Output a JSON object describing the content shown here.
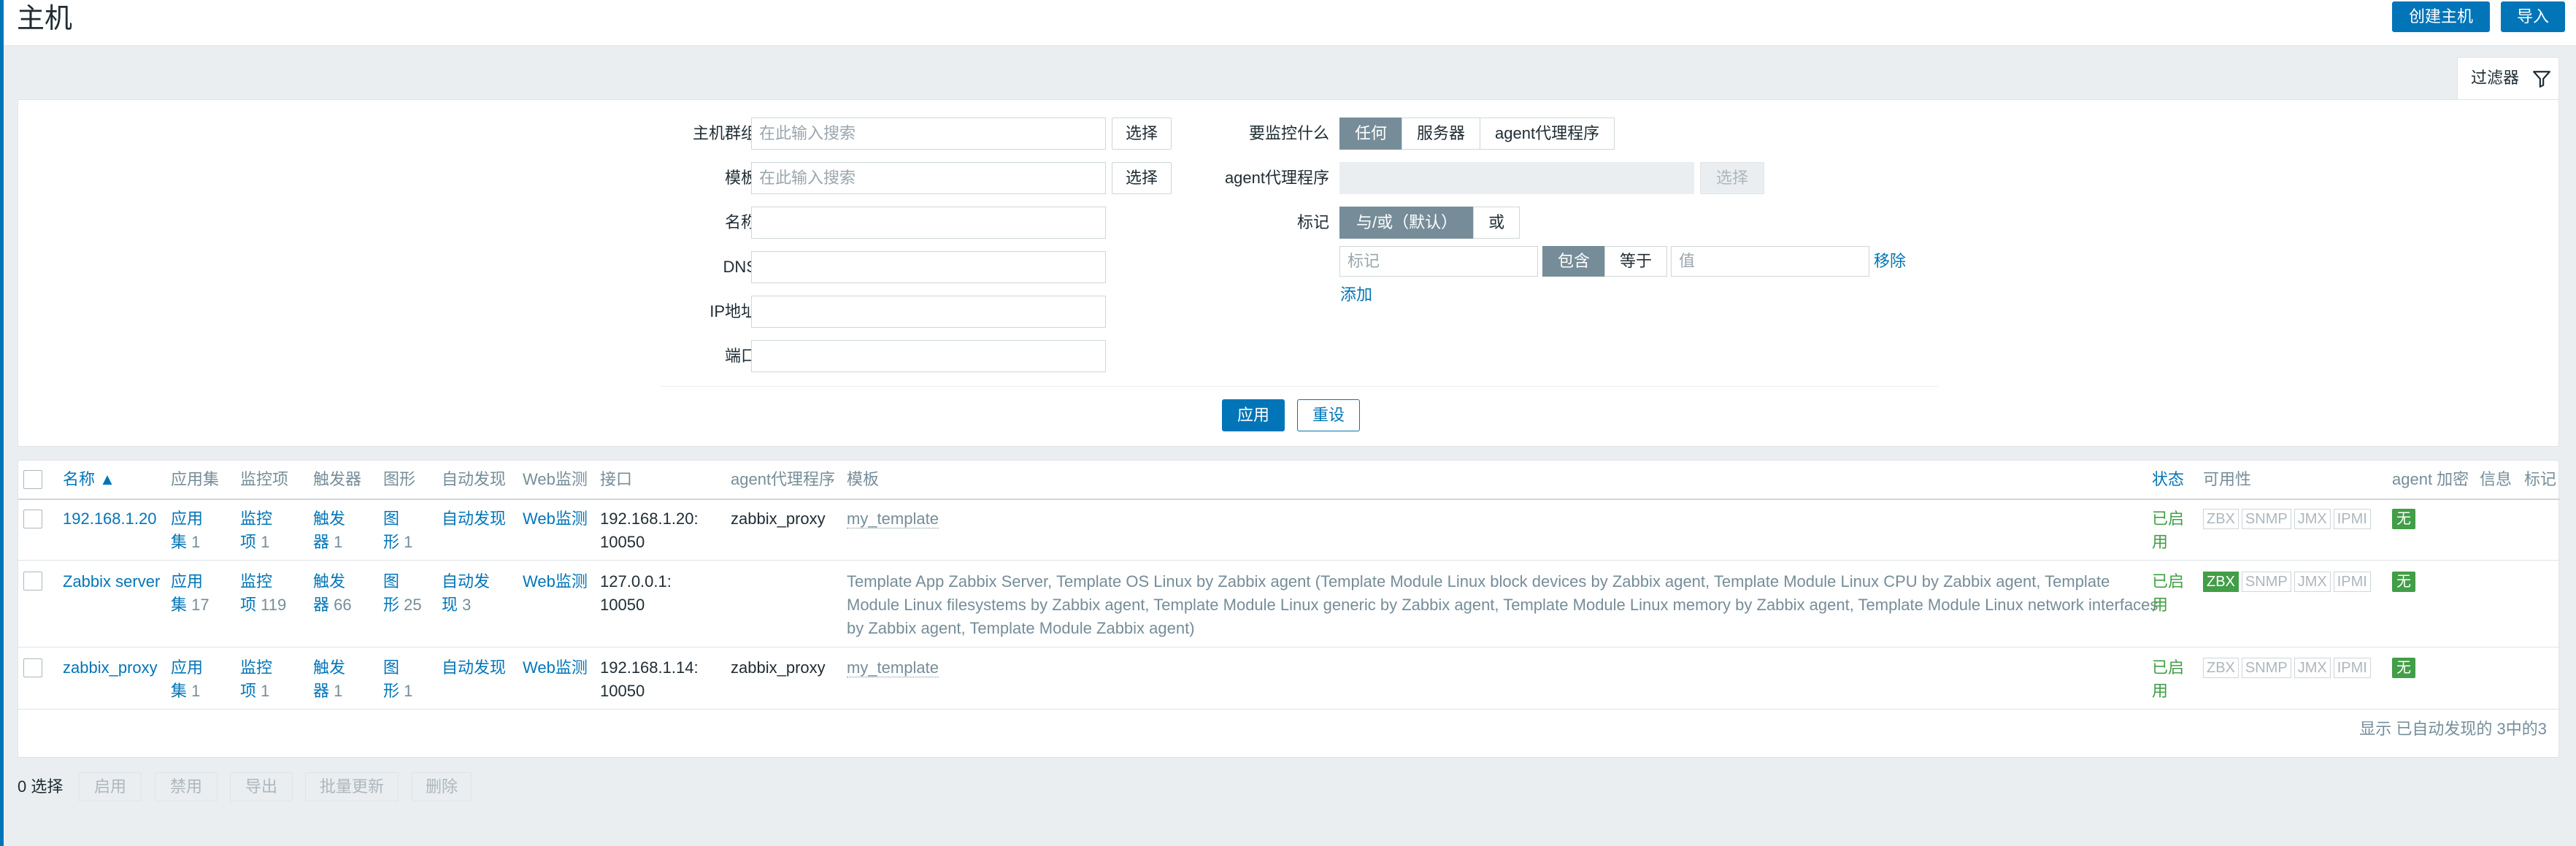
{
  "header": {
    "title": "主机",
    "create_host": "创建主机",
    "import": "导入"
  },
  "filter": {
    "tab_label": "过滤器",
    "host_group_label": "主机群组",
    "host_group_placeholder": "在此输入搜索",
    "template_label": "模板",
    "template_placeholder": "在此输入搜索",
    "select_label": "选择",
    "name_label": "名称",
    "dns_label": "DNS",
    "ip_label": "IP地址",
    "port_label": "端口",
    "monitored_by_label": "要监控什么",
    "monitored_by_options": [
      "任何",
      "服务器",
      "agent代理程序"
    ],
    "proxy_label": "agent代理程序",
    "proxy_select_label": "选择",
    "tags_label": "标记",
    "tags_mode_options": [
      "与/或（默认）",
      "或"
    ],
    "tag_placeholder": "标记",
    "tag_operator_options": [
      "包含",
      "等于"
    ],
    "value_placeholder": "值",
    "remove_label": "移除",
    "add_label": "添加",
    "apply_label": "应用",
    "reset_label": "重设"
  },
  "table": {
    "columns": {
      "name": "名称 ▲",
      "applications": "应用集",
      "items": "监控项",
      "triggers": "触发器",
      "graphs": "图形",
      "discovery": "自动发现",
      "web": "Web监测",
      "interface": "接口",
      "proxy": "agent代理程序",
      "templates": "模板",
      "status": "状态",
      "availability": "可用性",
      "encryption": "agent 加密",
      "info": "信息",
      "tags": "标记"
    },
    "rows": [
      {
        "name": "192.168.1.20",
        "app_a": "应用",
        "app_b": "集",
        "app_n": "1",
        "item_a": "监控",
        "item_b": "项",
        "item_n": "1",
        "trig_a": "触发",
        "trig_b": "器",
        "trig_n": "1",
        "graph_a": "图",
        "graph_b": "形",
        "graph_n": "1",
        "disc_a": "自动发现",
        "disc_b": "",
        "disc_n": "",
        "web": "Web监测",
        "iface_a": "192.168.1.20:",
        "iface_b": "10050",
        "proxy": "zabbix_proxy",
        "templates": "my_template",
        "status_a": "已启",
        "status_b": "用",
        "availability": [
          "ZBX",
          "SNMP",
          "JMX",
          "IPMI"
        ],
        "zbx_on": false,
        "encryption": "无"
      },
      {
        "name": "Zabbix server",
        "app_a": "应用",
        "app_b": "集",
        "app_n": "17",
        "item_a": "监控",
        "item_b": "项",
        "item_n": "119",
        "trig_a": "触发",
        "trig_b": "器",
        "trig_n": "66",
        "graph_a": "图",
        "graph_b": "形",
        "graph_n": "25",
        "disc_a": "自动发",
        "disc_b": "现",
        "disc_n": "3",
        "web": "Web监测",
        "iface_a": "127.0.0.1:",
        "iface_b": "10050",
        "proxy": "",
        "templates_line1": "Template App Zabbix Server, Template OS Linux by Zabbix agent (Template Module Linux block devices by Zabbix agent, Template Module Linux CPU by Zabbix agent, Template",
        "templates_line2": "Module Linux filesystems by Zabbix agent, Template Module Linux generic by Zabbix agent, Template Module Linux memory by Zabbix agent, Template Module Linux network interfaces",
        "templates_line3": "by Zabbix agent, Template Module Zabbix agent)",
        "status_a": "已启",
        "status_b": "用",
        "availability": [
          "ZBX",
          "SNMP",
          "JMX",
          "IPMI"
        ],
        "zbx_on": true,
        "encryption": "无"
      },
      {
        "name": "zabbix_proxy",
        "app_a": "应用",
        "app_b": "集",
        "app_n": "1",
        "item_a": "监控",
        "item_b": "项",
        "item_n": "1",
        "trig_a": "触发",
        "trig_b": "器",
        "trig_n": "1",
        "graph_a": "图",
        "graph_b": "形",
        "graph_n": "1",
        "disc_a": "自动发现",
        "disc_b": "",
        "disc_n": "",
        "web": "Web监测",
        "iface_a": "192.168.1.14:",
        "iface_b": "10050",
        "proxy": "zabbix_proxy",
        "templates": "my_template",
        "status_a": "已启",
        "status_b": "用",
        "availability": [
          "ZBX",
          "SNMP",
          "JMX",
          "IPMI"
        ],
        "zbx_on": false,
        "encryption": "无"
      }
    ],
    "footer": "显示 已自动发现的 3中的3"
  },
  "actions": {
    "selected": "0 选择",
    "enable": "启用",
    "disable": "禁用",
    "export": "导出",
    "mass_update": "批量更新",
    "delete": "删除"
  },
  "colors": {
    "accent": "#0275b8",
    "ok_green": "#429e47",
    "muted": "#768d99",
    "background": "#ebeef0"
  }
}
